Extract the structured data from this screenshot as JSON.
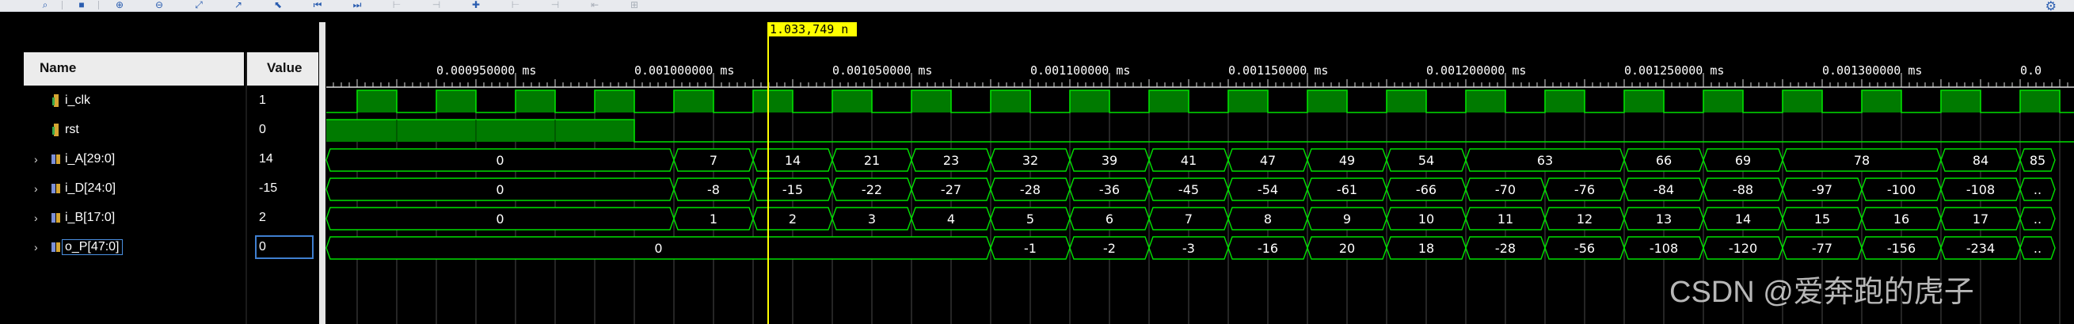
{
  "toolbar": {
    "icons": [
      "search-icon",
      "save-icon",
      "zoom-in-icon",
      "zoom-out-icon",
      "zoom-fit-icon",
      "cursor-icon",
      "marker-icon",
      "go-first-icon",
      "go-last-icon",
      "prev-transition-icon",
      "next-transition-icon",
      "add-marker-icon",
      "prev-marker-icon",
      "next-marker-icon",
      "swap-cursors-icon",
      "snap-icon"
    ],
    "settings_icon": "gear-icon"
  },
  "headers": {
    "name": "Name",
    "value": "Value"
  },
  "cursor": {
    "label": "1.033,749 n",
    "time_ns": 1033.749
  },
  "time_labels": [
    "0.000950000 ms",
    "0.001000000 ms",
    "0.001050000 ms",
    "0.001100000 ms",
    "0.001150000 ms",
    "0.001200000 ms",
    "0.001250000 ms",
    "0.001300000 ms",
    "0.0"
  ],
  "signals": [
    {
      "name": "i_clk",
      "value": "1",
      "type": "bit",
      "expandable": false
    },
    {
      "name": "rst",
      "value": "0",
      "type": "bit",
      "expandable": false
    },
    {
      "name": "i_A[29:0]",
      "value": "14",
      "type": "bus",
      "expandable": true
    },
    {
      "name": "i_D[24:0]",
      "value": "-15",
      "type": "bus",
      "expandable": true
    },
    {
      "name": "i_B[17:0]",
      "value": "2",
      "type": "bus",
      "expandable": true
    },
    {
      "name": "o_P[47:0]",
      "value": "0",
      "type": "bus",
      "expandable": true,
      "selected": true
    }
  ],
  "bus_values": {
    "i_A": [
      "0",
      "7",
      "14",
      "21",
      "23",
      "32",
      "39",
      "41",
      "47",
      "49",
      "54",
      "63",
      "66",
      "69",
      "78",
      "84",
      "85"
    ],
    "i_D": [
      "0",
      "-8",
      "-15",
      "-22",
      "-27",
      "-28",
      "-36",
      "-45",
      "-54",
      "-61",
      "-66",
      "-70",
      "-76",
      "-84",
      "-88",
      "-97",
      "-100",
      "-108",
      ".."
    ],
    "i_B": [
      "0",
      "1",
      "2",
      "3",
      "4",
      "5",
      "6",
      "7",
      "8",
      "9",
      "10",
      "11",
      "12",
      "13",
      "14",
      "15",
      "16",
      "17",
      ".."
    ],
    "o_P": [
      "0",
      "-1",
      "-2",
      "-3",
      "-16",
      "20",
      "18",
      "-28",
      "-56",
      "-108",
      "-120",
      "-77",
      "-156",
      "-234",
      ".."
    ]
  },
  "colors": {
    "wave_fill": "#007a00",
    "wave_line": "#00e000",
    "cursor": "#ffff00",
    "text": "#ffffff"
  },
  "watermark": "CSDN @爱奔跑的虎子"
}
